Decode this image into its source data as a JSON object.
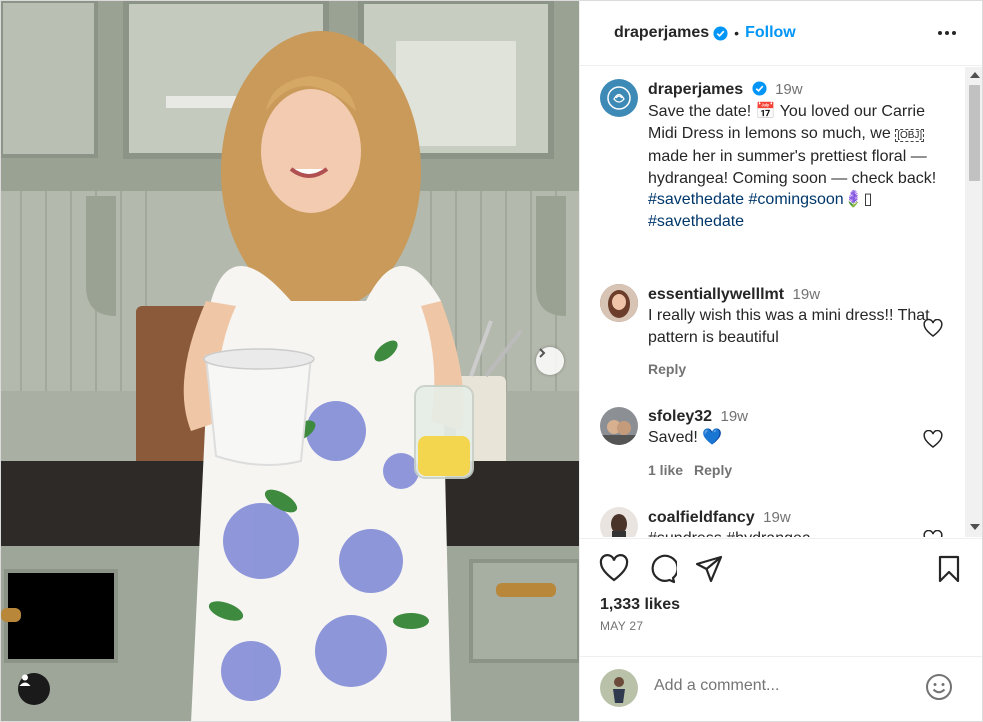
{
  "post": {
    "username": "draperjames",
    "follow_label": "Follow",
    "separator": "•"
  },
  "caption": {
    "username": "draperjames",
    "time": "19w",
    "text_1": "Save the date! ",
    "calendar_glyph": "📅",
    "text_2": " You loved our Carrie Midi Dress in lemons so much, we ",
    "obj_glyph": "[OBJ]",
    "text_3": " made her in summer's prettiest floral — hydrangea! Coming soon — check back! ",
    "hashtag_1": "#savethedate",
    "hashtag_2": "#comingsoon",
    "trailing_glyph": "🪻▯",
    "hashtag_3": "#savethedate"
  },
  "comments": [
    {
      "username": "essentiallywelllmt",
      "time": "19w",
      "text": "I really wish this was a mini dress!! That pattern is beautiful",
      "reply_label": "Reply",
      "likes": ""
    },
    {
      "username": "sfoley32",
      "time": "19w",
      "text": "Saved! ",
      "emoji": "💙",
      "likes": "1 like",
      "reply_label": "Reply"
    },
    {
      "username": "coalfieldfancy",
      "time": "19w",
      "text": "#sundress #hydrangea"
    }
  ],
  "actions": {
    "likes": "1,333 likes",
    "date": "MAY 27"
  },
  "add_comment": {
    "placeholder": "Add a comment..."
  },
  "icons": [
    "verified-badge-icon",
    "more-options-icon",
    "heart-icon",
    "comment-icon",
    "share-icon",
    "bookmark-icon",
    "emoji-icon",
    "chevron-right-icon",
    "user-tag-icon"
  ],
  "colors": {
    "follow": "#0095f6",
    "hashtag": "#00376b",
    "verified": "#0095f6"
  }
}
